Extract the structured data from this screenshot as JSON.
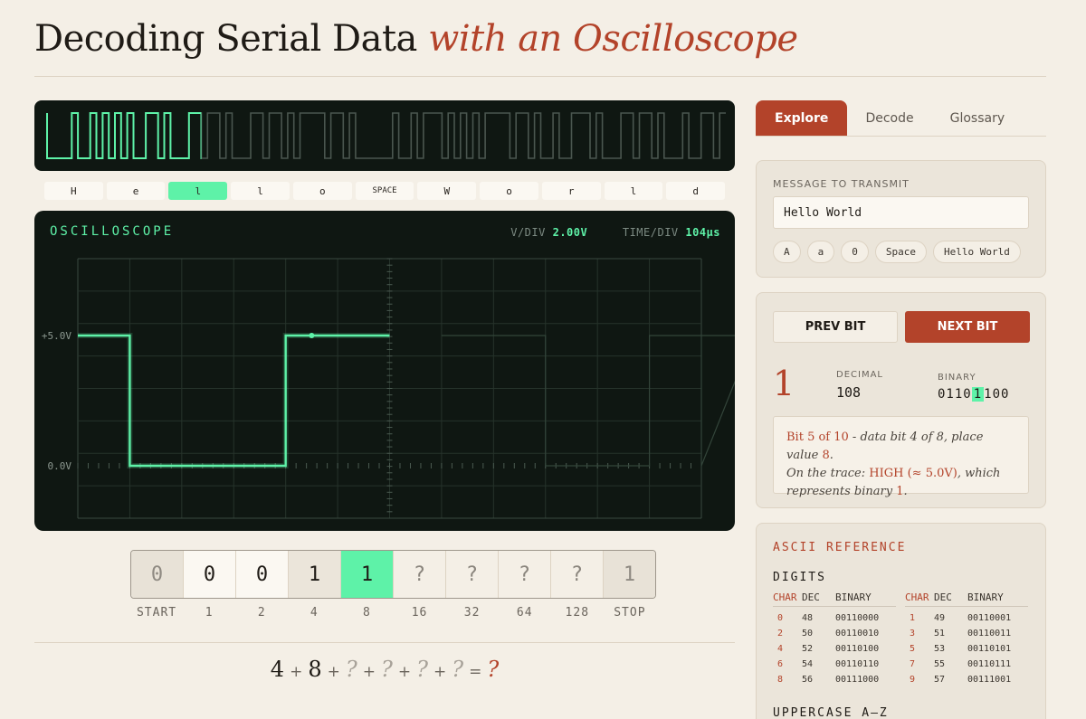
{
  "title": {
    "main": "Decoding Serial Data",
    "accent": "with an Oscilloscope"
  },
  "mini_wave": {
    "active_char_index": 2
  },
  "chars": [
    "H",
    "e",
    "l",
    "l",
    "o",
    "SPACE",
    "W",
    "o",
    "r",
    "l",
    "d"
  ],
  "scope": {
    "title": "OSCILLOSCOPE",
    "vdiv_label": "V/DIV",
    "vdiv_value": "2.00V",
    "tdiv_label": "TIME/DIV",
    "tdiv_value": "104µs",
    "y_labels": [
      "+5.0V",
      "0.0V"
    ],
    "trace_levels": [
      1,
      0,
      0,
      0,
      1,
      1
    ],
    "ghost_levels": [
      1,
      0,
      0,
      1,
      0,
      1,
      1
    ]
  },
  "bits": [
    {
      "value": "0",
      "label": "START",
      "state": "start"
    },
    {
      "value": "0",
      "label": "1",
      "state": "done"
    },
    {
      "value": "0",
      "label": "2",
      "state": "done"
    },
    {
      "value": "1",
      "label": "4",
      "state": "done2"
    },
    {
      "value": "1",
      "label": "8",
      "state": "cur"
    },
    {
      "value": "?",
      "label": "16",
      "state": "unk"
    },
    {
      "value": "?",
      "label": "32",
      "state": "unk"
    },
    {
      "value": "?",
      "label": "64",
      "state": "unk"
    },
    {
      "value": "?",
      "label": "128",
      "state": "unk"
    },
    {
      "value": "1",
      "label": "STOP",
      "state": "stop"
    }
  ],
  "sum": {
    "terms": [
      "4",
      "8",
      "?",
      "?",
      "?",
      "?"
    ],
    "plus": "+",
    "equals": "=",
    "result": "?"
  },
  "tabs": [
    "Explore",
    "Decode",
    "Glossary"
  ],
  "message": {
    "label": "MESSAGE TO TRANSMIT",
    "value": "Hello World",
    "presets": [
      "A",
      "a",
      "0",
      "Space",
      "Hello World"
    ]
  },
  "controls": {
    "prev": "PREV BIT",
    "next": "NEXT BIT"
  },
  "current": {
    "bit": "1",
    "decimal_label": "DECIMAL",
    "decimal": "108",
    "binary_label": "BINARY",
    "binary_pre": "0110",
    "binary_hl": "1",
    "binary_post": "100"
  },
  "explain": {
    "p1": "Bit 5 of 10",
    "p2": " - data bit 4 of 8, place value ",
    "p3": "8",
    "p4": ".",
    "p5": "On the trace: ",
    "p6": "HIGH (≈ 5.0V)",
    "p7": ", which represents binary ",
    "p8": "1",
    "p9": "."
  },
  "ascii": {
    "title": "ASCII REFERENCE",
    "digits_title": "DIGITS",
    "upper_title": "UPPERCASE A–Z",
    "headers": [
      "CHAR",
      "DEC",
      "BINARY"
    ],
    "left": [
      [
        "0",
        "48",
        "00110000"
      ],
      [
        "2",
        "50",
        "00110010"
      ],
      [
        "4",
        "52",
        "00110100"
      ],
      [
        "6",
        "54",
        "00110110"
      ],
      [
        "8",
        "56",
        "00111000"
      ]
    ],
    "right": [
      [
        "1",
        "49",
        "00110001"
      ],
      [
        "3",
        "51",
        "00110011"
      ],
      [
        "5",
        "53",
        "00110101"
      ],
      [
        "7",
        "55",
        "00110111"
      ],
      [
        "9",
        "57",
        "00111001"
      ]
    ]
  }
}
